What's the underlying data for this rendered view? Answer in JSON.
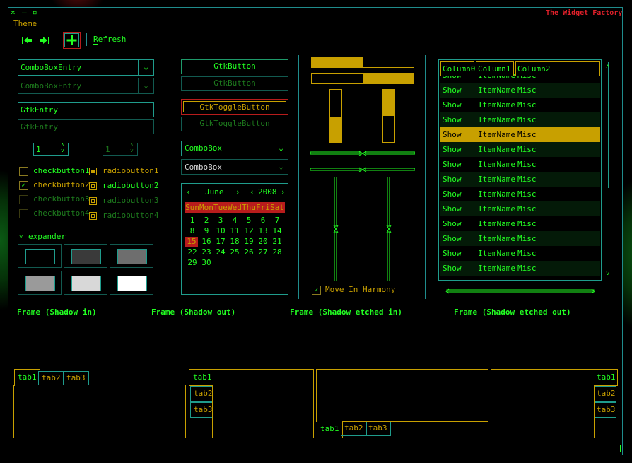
{
  "window": {
    "title": "The Widget Factory",
    "controls": [
      "×",
      "–",
      "▫"
    ]
  },
  "menu": {
    "theme": "Theme"
  },
  "toolbar": {
    "refresh": "Refresh"
  },
  "combo_entry": {
    "value": "ComboBoxEntry",
    "disabled_value": "ComboBoxEntry"
  },
  "entry": {
    "value": "GtkEntry",
    "disabled_value": "GtkEntry"
  },
  "spin": {
    "value": "1",
    "disabled_value": "1"
  },
  "checks": [
    "checkbutton1",
    "checkbutton2",
    "checkbutton3",
    "checkbutton4"
  ],
  "radios": [
    "radiobutton1",
    "radiobutton2",
    "radiobutton3",
    "radiobutton4"
  ],
  "expander": {
    "label": "expander"
  },
  "buttons": {
    "button": "GtkButton",
    "button_disabled": "GtkButton",
    "toggle": "GtkToggleButton",
    "toggle_disabled": "GtkToggleButton"
  },
  "combobox": {
    "value": "ComboBox",
    "disabled_value": "ComboBox"
  },
  "calendar": {
    "month": "June",
    "year": "2008",
    "days": [
      "Sun",
      "Mon",
      "Tue",
      "Wed",
      "Thu",
      "Fri",
      "Sat"
    ],
    "weeks": [
      [
        "1",
        "2",
        "3",
        "4",
        "5",
        "6",
        "7"
      ],
      [
        "8",
        "9",
        "10",
        "11",
        "12",
        "13",
        "14"
      ],
      [
        "15",
        "16",
        "17",
        "18",
        "19",
        "20",
        "21"
      ],
      [
        "22",
        "23",
        "24",
        "25",
        "26",
        "27",
        "28"
      ],
      [
        "29",
        "30",
        "",
        "",
        "",
        "",
        ""
      ]
    ],
    "selected": "15"
  },
  "progress": {
    "bar1": 0.5,
    "bar2": 0.5,
    "vbar1": 0.5,
    "vbar2": 0.5
  },
  "harmony": {
    "label": "Move In Harmony"
  },
  "tree": {
    "columns": [
      "Column0",
      "Column1",
      "Column2"
    ],
    "rows": [
      [
        "Show",
        "ItemName",
        "Misc"
      ],
      [
        "Show",
        "ItemName",
        "Misc"
      ],
      [
        "Show",
        "ItemName",
        "Misc"
      ],
      [
        "Show",
        "ItemName",
        "Misc"
      ],
      [
        "Show",
        "ItemName",
        "Misc"
      ],
      [
        "Show",
        "ItemName",
        "Misc"
      ],
      [
        "Show",
        "ItemName",
        "Misc"
      ],
      [
        "Show",
        "ItemName",
        "Misc"
      ],
      [
        "Show",
        "ItemName",
        "Misc"
      ],
      [
        "Show",
        "ItemName",
        "Misc"
      ],
      [
        "Show",
        "ItemName",
        "Misc"
      ],
      [
        "Show",
        "ItemName",
        "Misc"
      ],
      [
        "Show",
        "ItemName",
        "Misc"
      ],
      [
        "Show",
        "ItemName",
        "Misc"
      ]
    ],
    "selected_index": 4
  },
  "frames": [
    "Frame (Shadow in)",
    "Frame (Shadow out)",
    "Frame (Shadow etched in)",
    "Frame (Shadow etched out)"
  ],
  "tabs": [
    "tab1",
    "tab2",
    "tab3"
  ],
  "colors": {
    "accent": "#22ff22",
    "yellow": "#c8a000",
    "teal": "#1f9c8c",
    "red": "#b81c1c"
  }
}
